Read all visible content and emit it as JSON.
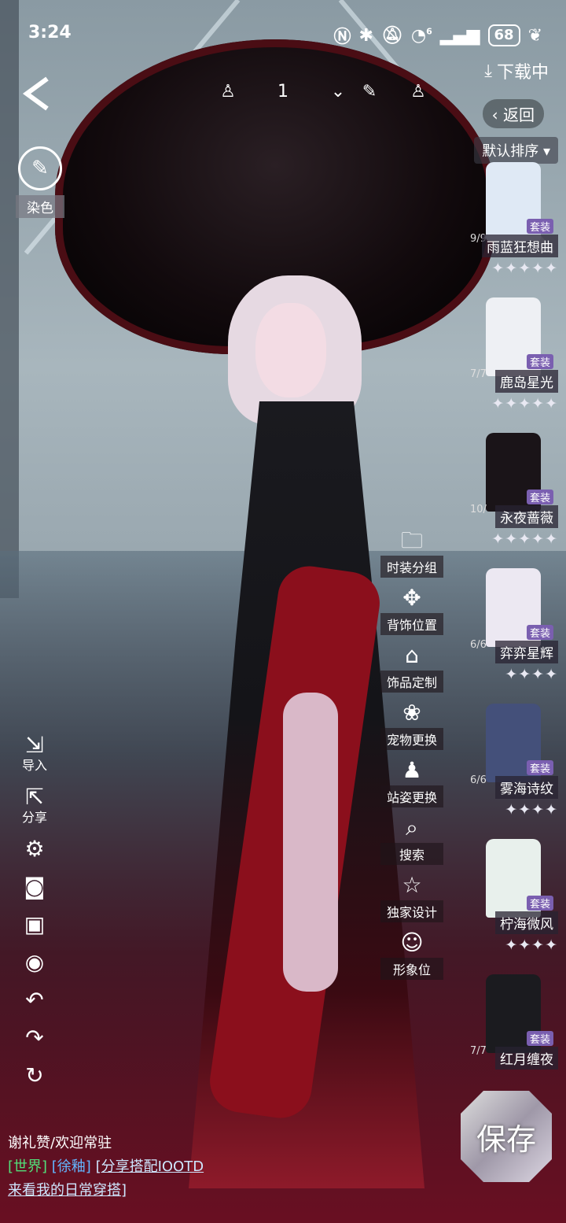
{
  "status_bar": {
    "time": "3:24",
    "battery": "68",
    "signal_label": "6"
  },
  "top_bar": {
    "page_number": "1",
    "download_label": "下载中",
    "return_label": "返回",
    "sort_label": "默认排序"
  },
  "dye": {
    "label": "染色"
  },
  "left_tools": [
    {
      "icon": "import-icon",
      "label": "导入"
    },
    {
      "icon": "share-icon",
      "label": "分享"
    },
    {
      "icon": "settings-icon",
      "label": ""
    },
    {
      "icon": "camera-icon",
      "label": ""
    },
    {
      "icon": "image-icon",
      "label": ""
    },
    {
      "icon": "eye-icon",
      "label": ""
    },
    {
      "icon": "undo-icon",
      "label": ""
    },
    {
      "icon": "redo-icon",
      "label": ""
    },
    {
      "icon": "reset-icon",
      "label": ""
    }
  ],
  "mid_menu": [
    {
      "icon": "folder-icon",
      "label": "时装分组"
    },
    {
      "icon": "back-accessory-icon",
      "label": "背饰位置"
    },
    {
      "icon": "bag-icon",
      "label": "饰品定制"
    },
    {
      "icon": "paw-icon",
      "label": "宠物更换"
    },
    {
      "icon": "pose-icon",
      "label": "站姿更换"
    },
    {
      "icon": "search-icon",
      "label": "搜索"
    },
    {
      "icon": "star-icon",
      "label": "独家设计"
    },
    {
      "icon": "portrait-icon",
      "label": "形象位"
    }
  ],
  "outfits": [
    {
      "name": "雨蓝狂想曲",
      "count": "9/9",
      "tag": "套装",
      "color": "#dfe9f5"
    },
    {
      "name": "鹿岛星光",
      "count": "7/7",
      "tag": "套装",
      "color": "#eef0f4"
    },
    {
      "name": "永夜蔷薇",
      "count": "10/",
      "tag": "套装",
      "color": "#1a1418"
    },
    {
      "name": "弈弈星辉",
      "count": "6/6",
      "tag": "套装",
      "color": "#ece8f2"
    },
    {
      "name": "雾海诗纹",
      "count": "6/6",
      "tag": "套装",
      "color": "#44507a"
    },
    {
      "name": "柠海微风",
      "count": "",
      "tag": "套装",
      "color": "#e8f0ec"
    },
    {
      "name": "红月缠夜",
      "count": "7/7",
      "tag": "套装",
      "color": "#1b1b1f"
    }
  ],
  "save": {
    "label": "保存"
  },
  "chat": {
    "line1": "谢礼赞/欢迎常驻",
    "world_tag": "[世界]",
    "user_tag": "[徐釉]",
    "message_a": "[分享搭配IOOTD",
    "message_b": "来看我的日常穿搭]"
  },
  "colors": {
    "accent": "#7a5fb0",
    "world": "#52e07a",
    "user": "#62b6ff"
  }
}
